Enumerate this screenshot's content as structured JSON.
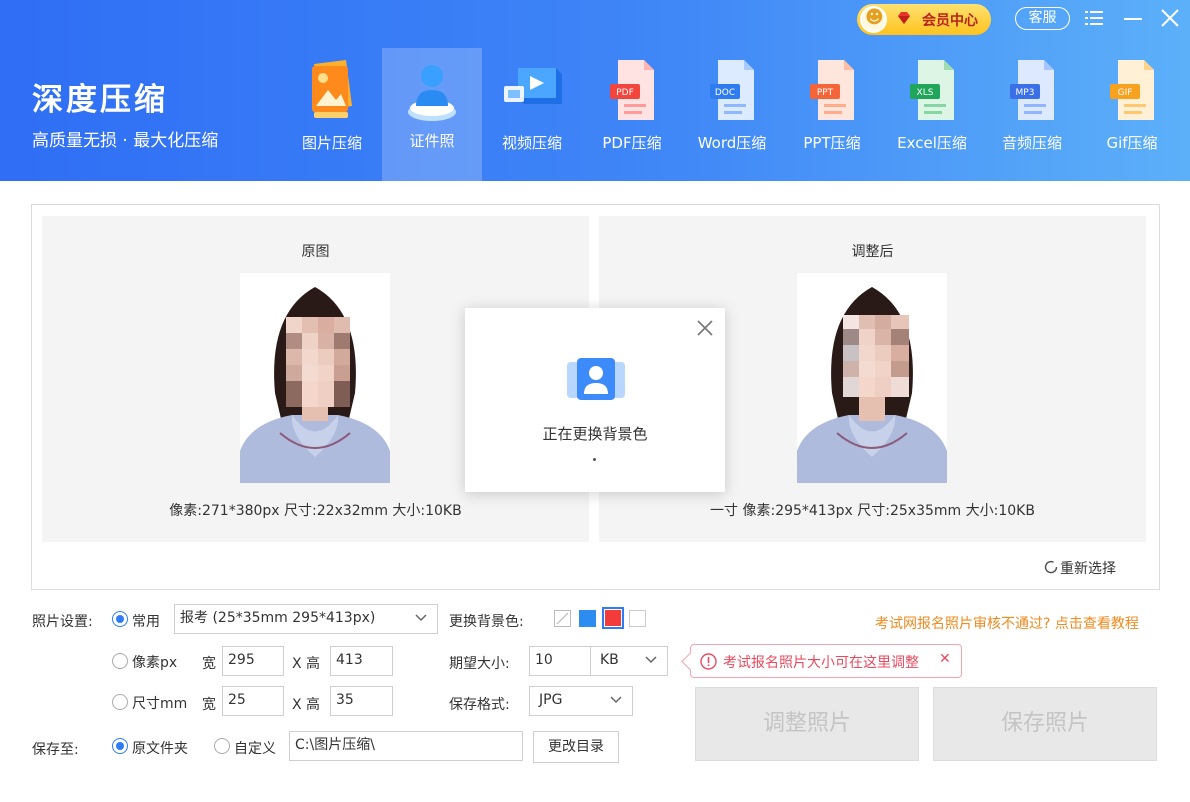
{
  "header": {
    "brand_title": "深度压缩",
    "brand_subtitle": "高质量无损 · 最大化压缩",
    "vip_label": "会员中心",
    "service_label": "客服",
    "tools": [
      {
        "label": "图片压缩",
        "icon": "image-compress-icon"
      },
      {
        "label": "证件照",
        "icon": "id-photo-icon",
        "active": true
      },
      {
        "label": "视频压缩",
        "icon": "video-compress-icon"
      },
      {
        "label": "PDF压缩",
        "icon": "pdf-compress-icon",
        "badge": "PDF"
      },
      {
        "label": "Word压缩",
        "icon": "word-compress-icon",
        "badge": "DOC"
      },
      {
        "label": "PPT压缩",
        "icon": "ppt-compress-icon",
        "badge": "PPT"
      },
      {
        "label": "Excel压缩",
        "icon": "excel-compress-icon",
        "badge": "XLS"
      },
      {
        "label": "音频压缩",
        "icon": "audio-compress-icon",
        "badge": "MP3"
      },
      {
        "label": "Gif压缩",
        "icon": "gif-compress-icon",
        "badge": "GIF"
      }
    ]
  },
  "preview": {
    "original_title": "原图",
    "original_info": "像素:271*380px  尺寸:22x32mm  大小:10KB",
    "adjusted_title": "调整后",
    "adjusted_info": "一寸  像素:295*413px  尺寸:25x35mm  大小:10KB",
    "reselect_label": "重新选择"
  },
  "modal": {
    "message": "正在更换背景色"
  },
  "settings": {
    "photo_settings_label": "照片设置:",
    "common_label": "常用",
    "preset_value": "报考 (25*35mm 295*413px)",
    "pixel_label": "像素px",
    "width_label": "宽",
    "height_label": "X 高",
    "pixel_width": "295",
    "pixel_height": "413",
    "size_label": "尺寸mm",
    "size_width": "25",
    "size_height": "35",
    "bg_color_label": "更换背景色:",
    "bg_colors": [
      "transparent",
      "#2d8cf0",
      "#f23b3b",
      "#ffffff"
    ],
    "bg_selected": "#f23b3b",
    "expected_size_label": "期望大小:",
    "expected_size_value": "10",
    "expected_size_unit": "KB",
    "format_label": "保存格式:",
    "format_value": "JPG",
    "save_to_label": "保存至:",
    "original_folder_label": "原文件夹",
    "custom_label": "自定义",
    "path_value": "C:\\图片压缩\\",
    "change_dir_label": "更改目录",
    "tip_link": "考试网报名照片审核不通过? 点击查看教程",
    "bubble_text": "考试报名照片大小可在这里调整",
    "adjust_button": "调整照片",
    "save_button": "保存照片"
  }
}
